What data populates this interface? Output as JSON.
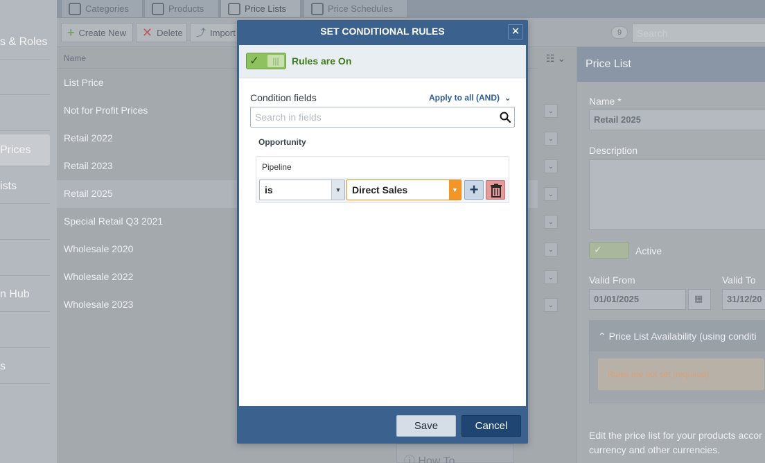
{
  "sidebar": {
    "items": [
      {
        "label": "s & Roles"
      },
      {
        "label": ""
      },
      {
        "label": ""
      },
      {
        "label": "Prices",
        "active": true
      },
      {
        "label": "ists"
      },
      {
        "label": ""
      },
      {
        "label": ""
      },
      {
        "label": "n Hub"
      },
      {
        "label": ""
      },
      {
        "label": "s"
      }
    ]
  },
  "tabs": [
    {
      "label": "Categories",
      "icon": "hierarchy-icon"
    },
    {
      "label": "Products",
      "icon": "box-icon"
    },
    {
      "label": "Price Lists",
      "icon": "price-list-icon",
      "active": true
    },
    {
      "label": "Price Schedules",
      "icon": "dollar-icon"
    }
  ],
  "toolbar": {
    "create_label": "Create New",
    "delete_label": "Delete",
    "import_label": "Import",
    "count": "9",
    "search_placeholder": "Search"
  },
  "list": {
    "column_name": "Name",
    "rows": [
      "List Price",
      "Not for Profit Prices",
      "Retail 2022",
      "Retail 2023",
      "Retail 2025",
      "Special Retail Q3 2021",
      "Wholesale 2020",
      "Wholesale 2022",
      "Wholesale 2023"
    ],
    "selected_index": 4
  },
  "detail": {
    "title": "Price List",
    "name_label": "Name *",
    "name_value": "Retail 2025",
    "description_label": "Description",
    "active_label": "Active",
    "valid_from_label": "Valid From",
    "valid_from_value": "01/01/2025",
    "valid_to_label": "Valid To",
    "valid_to_value": "31/12/20",
    "availability_title": "Price List Availability (using conditi",
    "availability_warning": "Rules are not set (required)",
    "footer_text": "Edit the price list for your products accor currency and other currencies."
  },
  "howto": {
    "label": "How To"
  },
  "modal": {
    "title": "SET CONDITIONAL RULES",
    "toggle_label": "Rules are On",
    "condition_fields_label": "Condition fields",
    "apply_all_label": "Apply to all (AND)",
    "search_placeholder": "Search in fields",
    "group_title": "Opportunity",
    "rule": {
      "field": "Pipeline",
      "operator": "is",
      "value": "Direct Sales"
    },
    "save_label": "Save",
    "cancel_label": "Cancel"
  },
  "colors": {
    "modal_header": "#3b618f",
    "toggle_on": "#8fc160",
    "value_accent": "#f3962a",
    "delete_button": "#e79a9a",
    "cancel_button": "#1f4572"
  }
}
